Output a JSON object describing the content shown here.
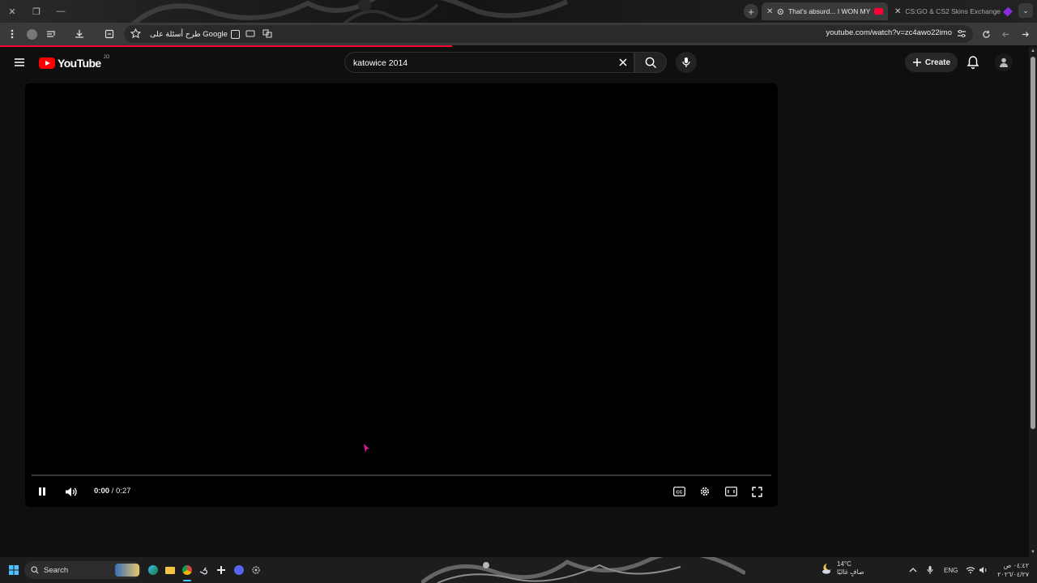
{
  "browser": {
    "tabs": [
      {
        "title": "That's absurd... I WON MY",
        "active": true
      },
      {
        "title": "CS:GO & CS2 Skins Exchange",
        "active": false
      }
    ],
    "omnibox_chip": "طرح أسئلة على Google",
    "url": "youtube.com/watch?v=zc4awo22imo"
  },
  "youtube": {
    "logo_text": "YouTube",
    "country_code": "JO",
    "search_query": "katowice 2014",
    "create_label": "Create"
  },
  "player": {
    "current_time": "0:00",
    "separator": " / ",
    "duration": "0:27",
    "progress_fraction": 0.0
  },
  "taskbar": {
    "search_label": "Search",
    "weather_temp": "14°C",
    "weather_desc": "صافٍ غالبًا",
    "language": "ENG",
    "time": "٠٤:٤٢ ص",
    "date": "٢٠٢٦/٠٤/٢٧"
  },
  "colors": {
    "youtube_red": "#ff0000",
    "progress_red": "#ff0033",
    "background": "#0f0f0f"
  }
}
